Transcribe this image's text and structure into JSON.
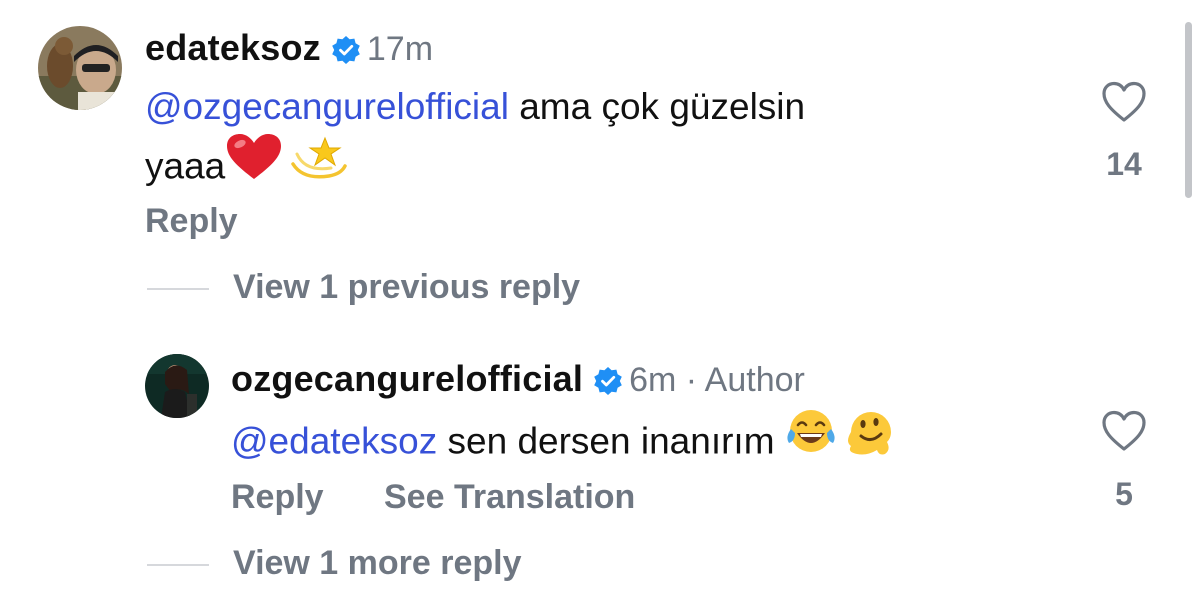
{
  "comments": [
    {
      "username": "edateksoz",
      "verified": true,
      "time": "17m",
      "mention": "@ozgecangurelofficial",
      "text_line1": " ama çok güzelsin",
      "text_line2": "yaaa",
      "emojis": [
        "red-heart",
        "dizzy-star"
      ],
      "reply_label": "Reply",
      "likes": "14"
    },
    {
      "username": "ozgecangurelofficial",
      "verified": true,
      "time": "6m",
      "separator": " · ",
      "author_label": "Author",
      "mention": "@edateksoz",
      "text": " sen dersen inanırım ",
      "emojis": [
        "face-with-tears-of-joy",
        "melting-face"
      ],
      "reply_label": "Reply",
      "translation_label": "See Translation",
      "likes": "5"
    }
  ],
  "view_previous": "View 1 previous reply",
  "view_more": "View 1 more reply",
  "colors": {
    "mention": "#3751d8",
    "muted": "#6f7782",
    "verified": "#1f8ff5",
    "heart_emoji": "#e0202e"
  }
}
